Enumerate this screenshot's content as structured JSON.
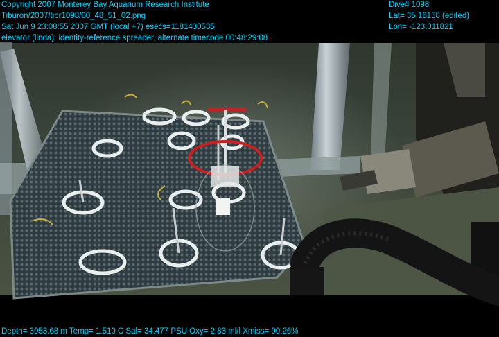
{
  "overlay": {
    "top_left": {
      "copyright": "Copyright 2007 Monterey Bay Aquarium Research Institute",
      "filename": "Tiburon/2007/tibr1098/00_48_51_02.png",
      "timestamp": "Sat Jun  9 23:08:55 2007 GMT (local +7)  esecs=1181430535",
      "description": "elevator (linda): identity-reference spreader, alternate timecode 00:48:29:08"
    },
    "top_right": {
      "dive": "Dive# 1098",
      "lat": "Lat= 35.16158 (edited)",
      "lon": "Lon= -123.011821"
    },
    "bottom": {
      "sensors": "Depth= 3953.68 m  Temp= 1.510 C  Sal= 34.477 PSU  Oxy= 2.83 ml/l  Xmiss= 90.26%"
    }
  },
  "colors": {
    "overlay_text": "#00d4ff",
    "water": "#3a443a",
    "handle_red": "#cc2020"
  },
  "scene": {
    "subject": "underwater-elevator-platform",
    "objects": [
      "mesh-platform",
      "core-tube-rings",
      "red-handle-spreader",
      "robotic-manipulator-arm",
      "suction-hose",
      "metal-support-poles"
    ]
  }
}
